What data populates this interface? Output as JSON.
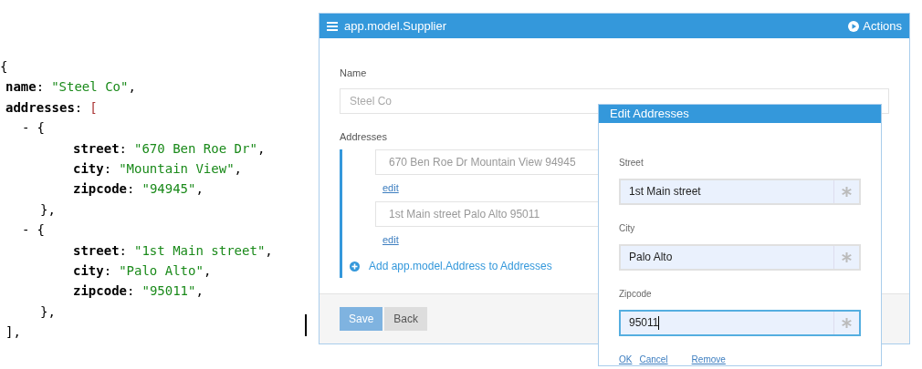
{
  "code": {
    "open": "{",
    "name": {
      "key": "name",
      "sep": ":",
      "value": "\"Steel Co\"",
      "end": ","
    },
    "addresses": {
      "key": "addresses",
      "sep": ":",
      "open": "[",
      "close": "],",
      "items": [
        {
          "bullet": "-",
          "open": "{",
          "close": "},",
          "fields": [
            {
              "key": "street",
              "sep": ":",
              "value": "\"670 Ben Roe Dr\"",
              "end": ","
            },
            {
              "key": "city",
              "sep": ":",
              "value": "\"Mountain View\"",
              "end": ","
            },
            {
              "key": "zipcode",
              "sep": ":",
              "value": "\"94945\"",
              "end": ","
            }
          ]
        },
        {
          "bullet": "-",
          "open": "{",
          "close": "},",
          "fields": [
            {
              "key": "street",
              "sep": ":",
              "value": "\"1st Main street\"",
              "end": ","
            },
            {
              "key": "city",
              "sep": ":",
              "value": "\"Palo Alto\"",
              "end": ","
            },
            {
              "key": "zipcode",
              "sep": ":",
              "value": "\"95011\"",
              "end": ","
            }
          ]
        }
      ]
    }
  },
  "form": {
    "title": "app.model.Supplier",
    "actions": "Actions",
    "name_label": "Name",
    "name_value": "Steel Co",
    "addresses_label": "Addresses",
    "addresses": [
      {
        "summary": "670 Ben Roe Dr Mountain View 94945",
        "edit": "edit"
      },
      {
        "summary": "1st Main street Palo Alto 95011",
        "edit": "edit"
      }
    ],
    "add_link": "Add app.model.Address to Addresses",
    "buttons": [
      {
        "label": "Save",
        "kind": "primary"
      },
      {
        "label": "Back",
        "kind": "default"
      }
    ]
  },
  "dialog": {
    "title": "Edit Addresses",
    "fields": [
      {
        "label": "Street",
        "value": "1st Main street",
        "focused": false
      },
      {
        "label": "City",
        "value": "Palo Alto",
        "focused": false
      },
      {
        "label": "Zipcode",
        "value": "95011",
        "focused": true
      }
    ],
    "links": [
      "OK",
      "Cancel",
      "Remove"
    ]
  }
}
